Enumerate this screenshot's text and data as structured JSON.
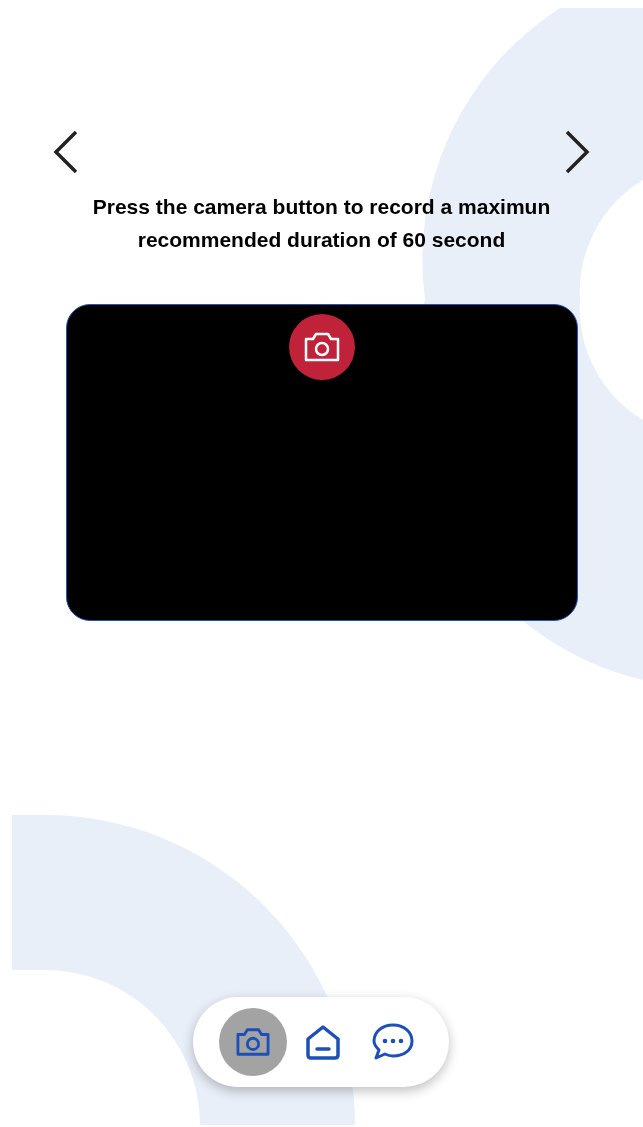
{
  "header": {
    "instruction": "Press the camera button to record a maximun recommended duration of 60 second"
  },
  "camera_preview": {
    "recording": false
  },
  "nav": [
    {
      "kind": "camera",
      "selected": true
    },
    {
      "kind": "home",
      "selected": false
    },
    {
      "kind": "chat",
      "selected": false
    }
  ]
}
